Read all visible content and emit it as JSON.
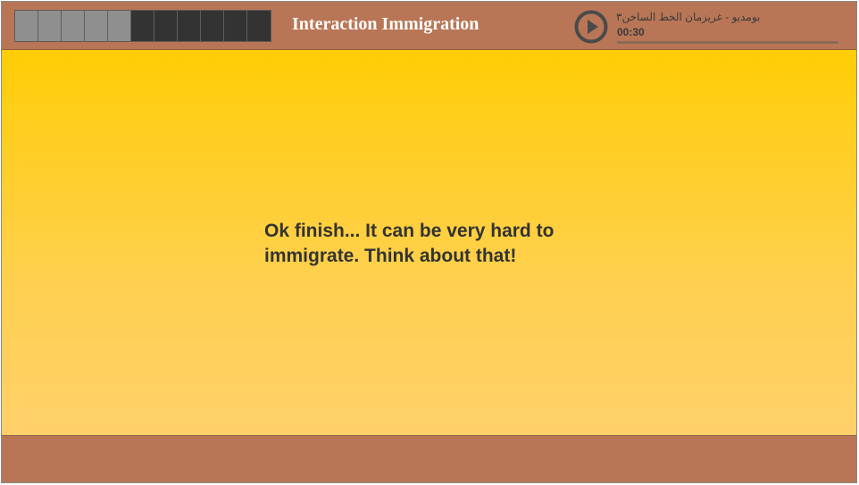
{
  "header": {
    "title": "Interaction Immigration",
    "progress": {
      "total_steps": 11,
      "completed_steps": 5
    }
  },
  "player": {
    "play_icon": "play-circle-icon",
    "track_title": "بومديو - غريزمان الخط الساخن٣",
    "time": "00:30",
    "seek_fraction": 0
  },
  "main": {
    "message": "Ok finish... It can be very hard to immigrate. Think about that!"
  },
  "colors": {
    "header_bg": "#b87656",
    "content_top": "#ffcd05",
    "content_bottom": "#ffd06a",
    "progress_done": "#8f8f8f",
    "progress_todo": "#333333"
  }
}
